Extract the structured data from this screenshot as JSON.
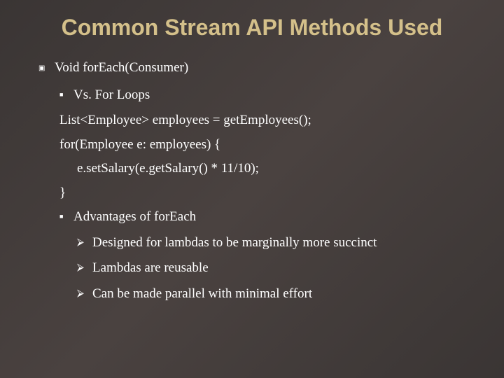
{
  "title": "Common Stream API Methods Used",
  "bullets": {
    "main": "Void forEach(Consumer)",
    "sub1": "Vs. For Loops",
    "code1": "List<Employee> employees = getEmployees();",
    "code2": "for(Employee e: employees) {",
    "code3": "e.setSalary(e.getSalary() * 11/10);",
    "code4": "}",
    "sub2": "Advantages of forEach",
    "adv1": "Designed for lambdas to be marginally more succinct",
    "adv2": "Lambdas are reusable",
    "adv3": "Can be made parallel with minimal effort"
  }
}
